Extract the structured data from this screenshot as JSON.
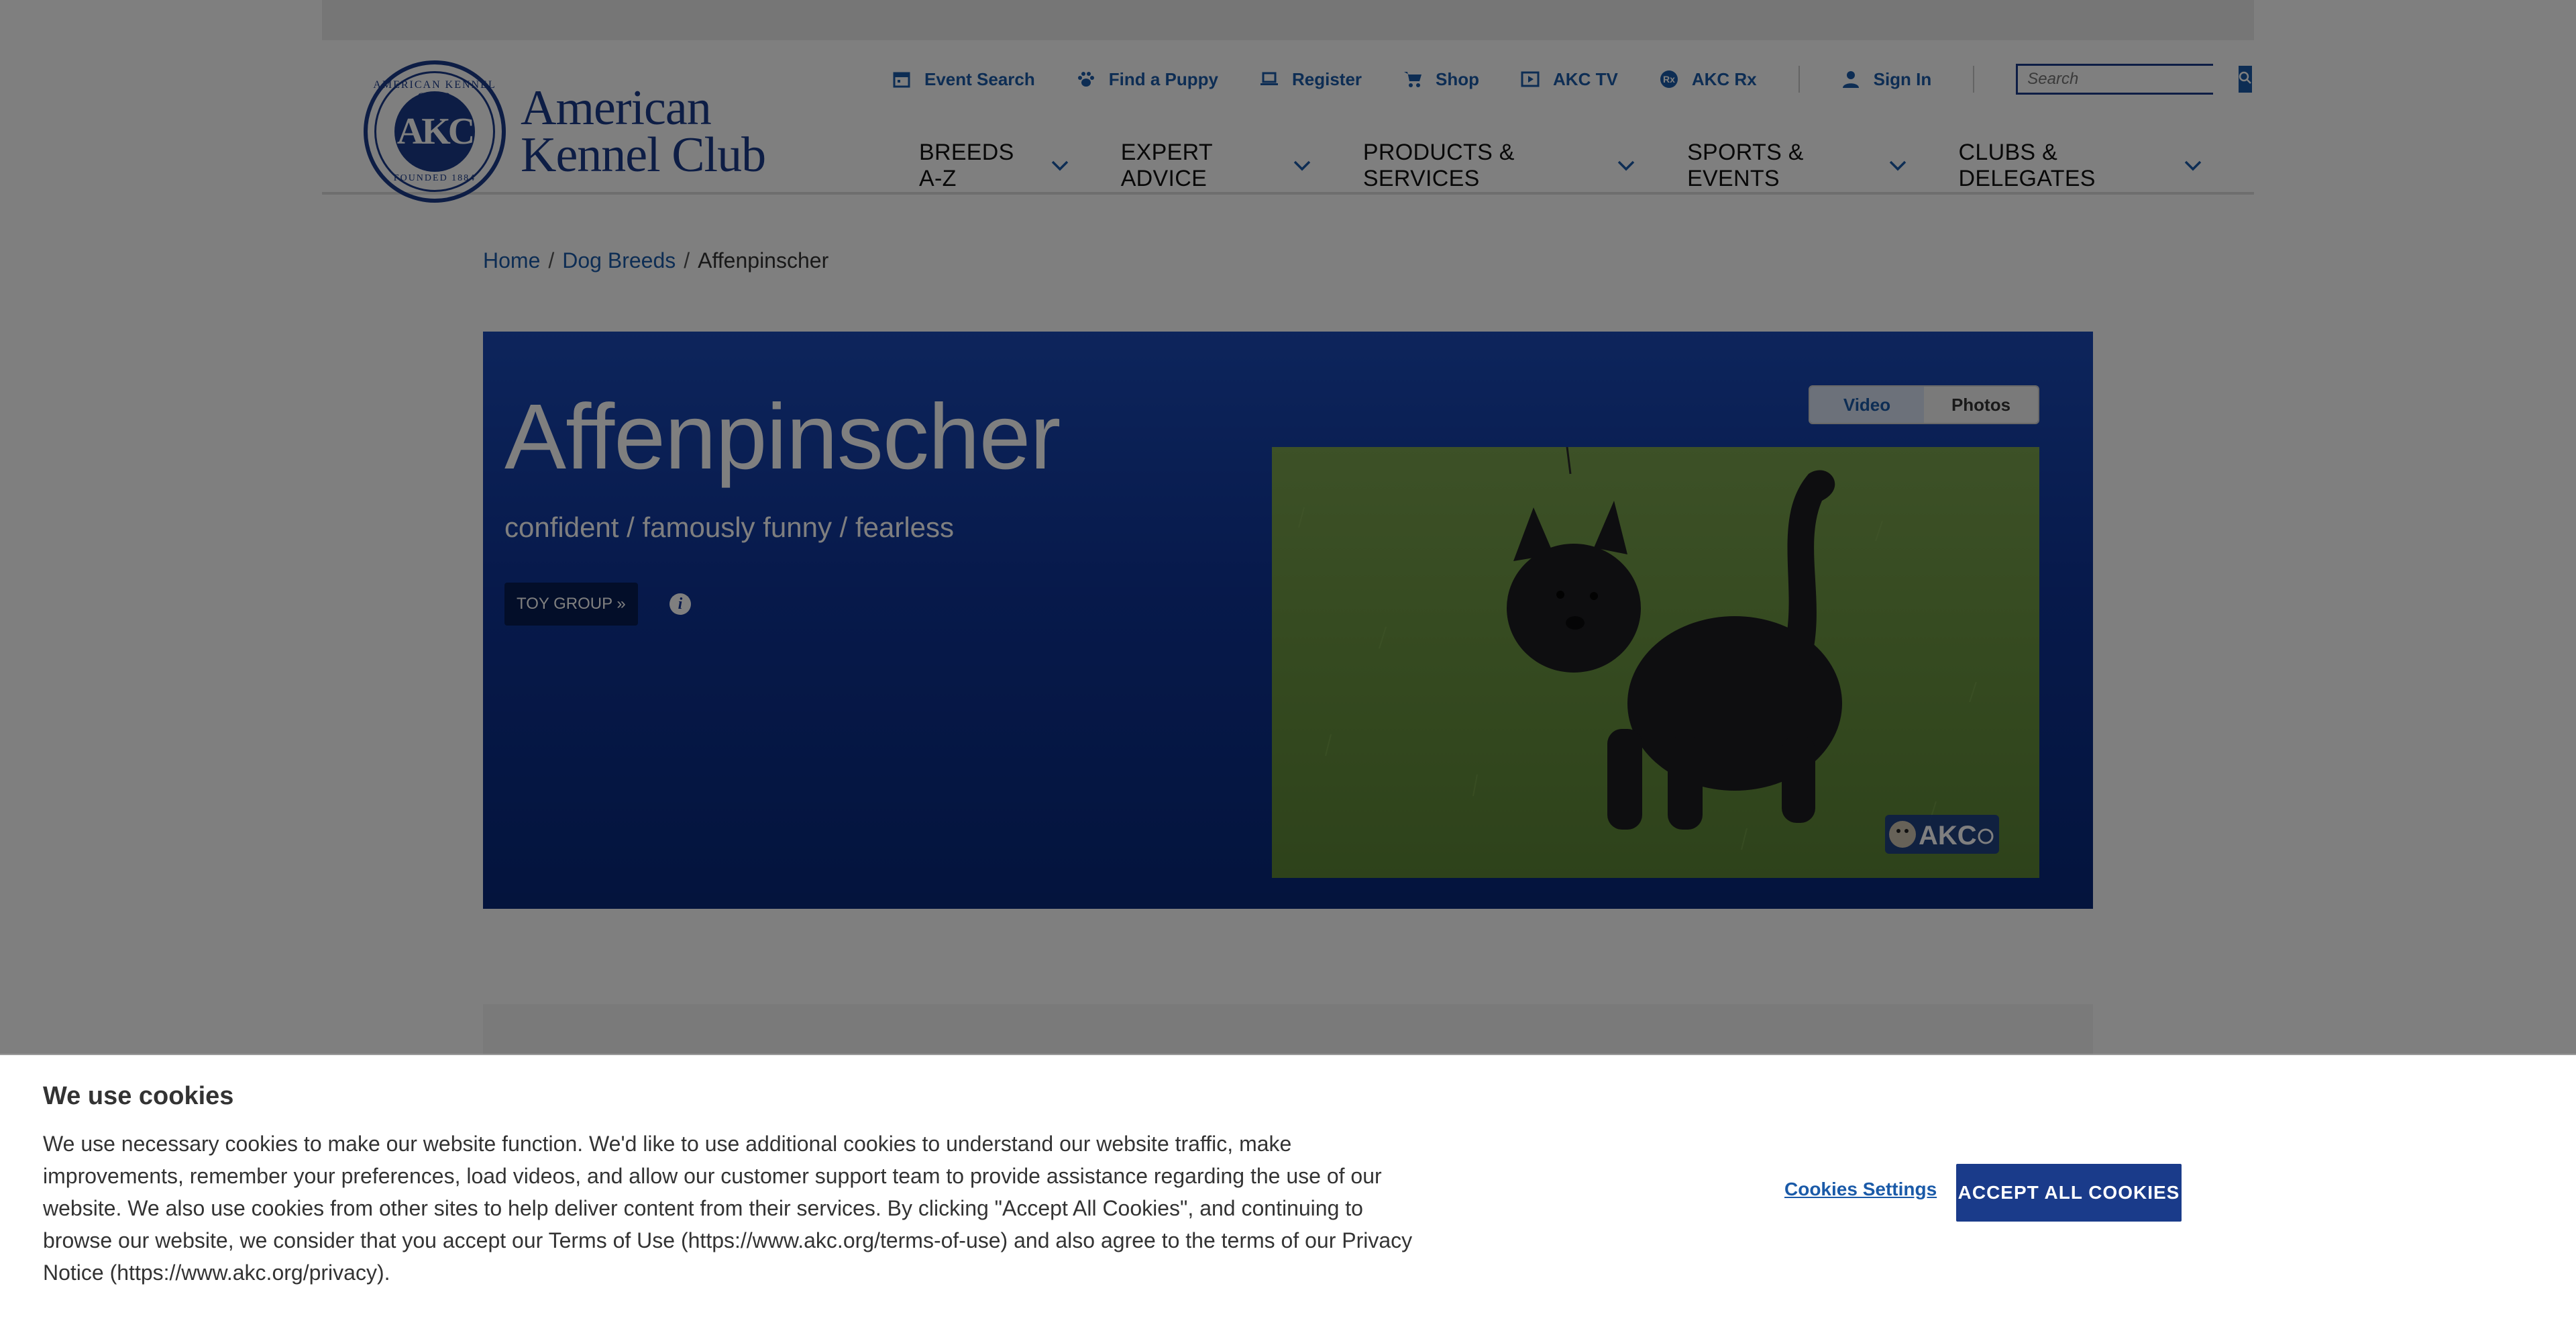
{
  "brand": {
    "seal_text": "AMERICAN KENNEL CLUB",
    "seal_initials": "AKC",
    "seal_founded": "FOUNDED 1884",
    "wordmark_line1": "American",
    "wordmark_line2": "Kennel Club",
    "primary_color": "#1a3b8a"
  },
  "utility_nav": [
    {
      "label": "Event Search",
      "icon": "calendar-icon"
    },
    {
      "label": "Find a Puppy",
      "icon": "paw-icon"
    },
    {
      "label": "Register",
      "icon": "laptop-icon"
    },
    {
      "label": "Shop",
      "icon": "cart-icon"
    },
    {
      "label": "AKC TV",
      "icon": "play-icon"
    },
    {
      "label": "AKC Rx",
      "icon": "rx-icon"
    },
    {
      "label": "Sign In",
      "icon": "user-icon"
    }
  ],
  "search": {
    "placeholder": "Search"
  },
  "main_nav": [
    {
      "label": "BREEDS A-Z"
    },
    {
      "label": "EXPERT ADVICE"
    },
    {
      "label": "PRODUCTS & SERVICES"
    },
    {
      "label": "SPORTS & EVENTS"
    },
    {
      "label": "CLUBS & DELEGATES"
    }
  ],
  "breadcrumb": {
    "home": "Home",
    "section": "Dog Breeds",
    "current": "Affenpinscher"
  },
  "hero": {
    "title": "Affenpinscher",
    "subtitle": "confident / famously funny / fearless",
    "group_button": "TOY GROUP »",
    "media_tabs": {
      "video": "Video",
      "photos": "Photos"
    },
    "video_watermark": "AKC",
    "background_color": "#0e3396"
  },
  "cookie_banner": {
    "title": "We use cookies",
    "body": "We use necessary cookies to make our website function. We'd like to use additional cookies to understand our website traffic, make improvements, remember your preferences, load videos, and allow our customer support team to provide assistance regarding the use of our website. We also use cookies from other sites to help deliver content from their services. By clicking \"Accept All Cookies\", and continuing to browse our website, we consider that you accept our Terms of Use (https://www.akc.org/terms-of-use) and also agree to the terms of our Privacy Notice (https://www.akc.org/privacy).",
    "settings_label": "Cookies Settings",
    "accept_label": "ACCEPT ALL COOKIES"
  }
}
